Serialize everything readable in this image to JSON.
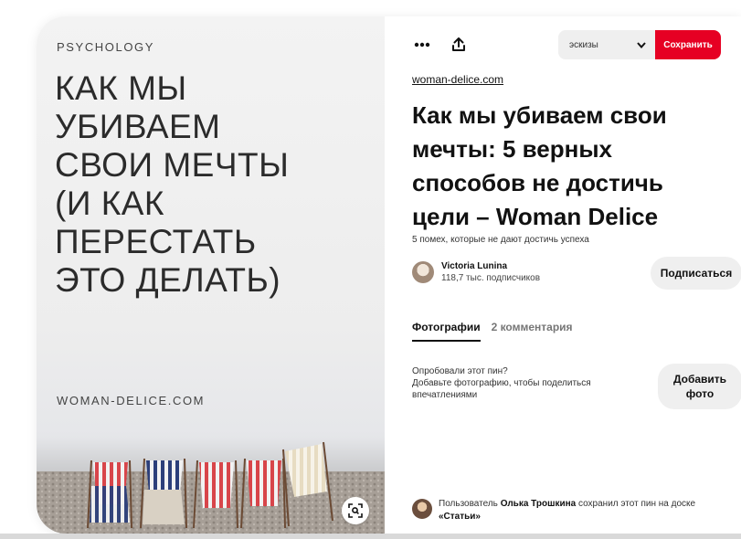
{
  "image": {
    "kicker": "PSYCHOLOGY",
    "headline_lines": [
      "КАК МЫ",
      "УБИВАЕМ",
      "СВОИ МЕЧТЫ",
      "(И КАК",
      "ПЕРЕСТАТЬ",
      "ЭТО ДЕЛАТЬ)"
    ],
    "source": "WOMAN-DELICE.COM",
    "lens_icon": "visual-search-icon"
  },
  "toolbar": {
    "more_icon": "more-dots-icon",
    "share_icon": "share-upload-icon",
    "board_value": "эскизы",
    "save_label": "Сохранить",
    "save_color": "#e60023"
  },
  "pin": {
    "source_link": "woman-delice.com",
    "title": "Как мы убиваем свои мечты: 5 верных способов не достичь цели – Woman Delice",
    "description": "5 помех, которые не дают достичь успеха"
  },
  "author": {
    "name": "Victoria Lunina",
    "subscribers": "118,7 тыс. подписчиков",
    "follow_label": "Подписаться"
  },
  "tabs": [
    {
      "label": "Фотографии",
      "active": true
    },
    {
      "label": "2 комментария",
      "active": false
    }
  ],
  "tried": {
    "question": "Опробовали этот пин?",
    "prompt": "Добавьте фотографию, чтобы поделиться впечатлениями",
    "button_line1": "Добавить",
    "button_line2": "фото"
  },
  "saved_by": {
    "prefix": "Пользователь",
    "user": "Олька Трошкина",
    "middle": "сохранил этот пин на доске",
    "board": "«Статьи»"
  }
}
